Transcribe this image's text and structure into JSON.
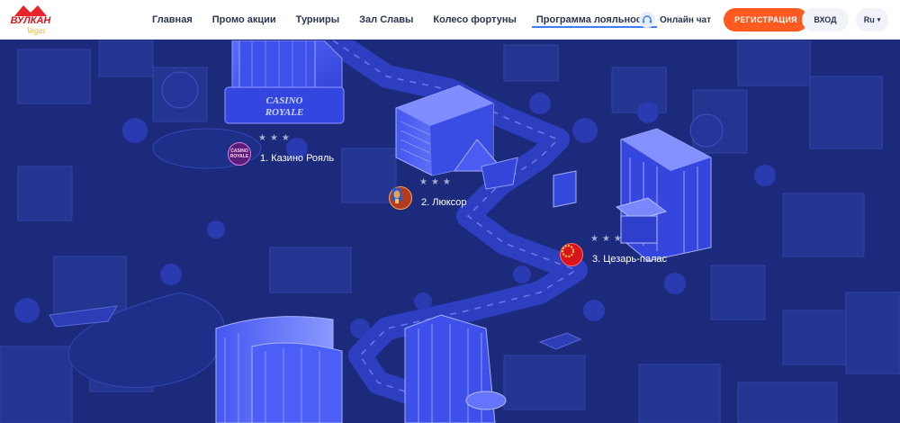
{
  "brand": {
    "logo_text_top": "ВУЛКАН",
    "logo_text_bottom": "Vegas"
  },
  "nav": {
    "items": [
      {
        "label": "Главная"
      },
      {
        "label": "Промо акции"
      },
      {
        "label": "Турниры"
      },
      {
        "label": "Зал Славы"
      },
      {
        "label": "Колесо фортуны"
      },
      {
        "label": "Программа лояльности",
        "active": true
      }
    ]
  },
  "header": {
    "chat_label": "Онлайн чат",
    "register_label": "РЕГИСТРАЦИЯ",
    "login_label": "ВХОД",
    "language": "Ru"
  },
  "map": {
    "casino_sign": "CASINO ROYALE",
    "levels": [
      {
        "label": "1. Казино Рояль",
        "stars": "★★★",
        "badge_icon": "casino-royale-badge-icon",
        "badge_text": "CASINO ROYALE"
      },
      {
        "label": "2. Люксор",
        "stars": "★★★",
        "badge_icon": "pharaoh-badge-icon"
      },
      {
        "label": "3. Цезарь-палас",
        "stars": "★★★",
        "badge_icon": "laurel-wreath-badge-icon"
      }
    ]
  },
  "colors": {
    "map_bg": "#1b2a7a",
    "building": "#3a4fe0",
    "road": "#2f43c7",
    "accent": "#ff5a1f",
    "nav_active": "#3f7df2"
  }
}
